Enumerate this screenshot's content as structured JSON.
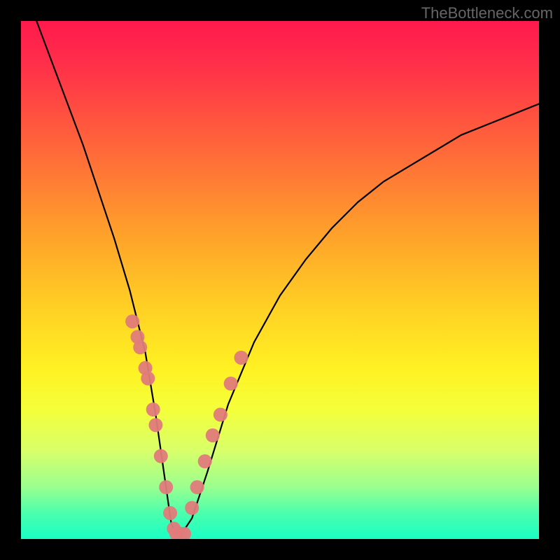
{
  "watermark": "TheBottleneck.com",
  "chart_data": {
    "type": "line",
    "title": "",
    "xlabel": "",
    "ylabel": "",
    "xlim": [
      0,
      100
    ],
    "ylim": [
      0,
      100
    ],
    "series": [
      {
        "name": "bottleneck-curve",
        "type": "line",
        "color": "#000000",
        "x": [
          3,
          6,
          9,
          12,
          15,
          18,
          21,
          24,
          26,
          28,
          29,
          30,
          31,
          33,
          36,
          40,
          45,
          50,
          55,
          60,
          65,
          70,
          75,
          80,
          85,
          90,
          95,
          100
        ],
        "y": [
          100,
          92,
          84,
          76,
          67,
          58,
          48,
          36,
          24,
          10,
          3,
          1,
          1,
          4,
          13,
          26,
          38,
          47,
          54,
          60,
          65,
          69,
          72,
          75,
          78,
          80,
          82,
          84
        ]
      },
      {
        "name": "highlight-dots-left",
        "type": "scatter",
        "color": "#e07b7b",
        "x": [
          21.5,
          22.5,
          23.0,
          24.0,
          24.5,
          25.5,
          26.0,
          27.0,
          28.0,
          28.8,
          29.5
        ],
        "y": [
          42,
          39,
          37,
          33,
          31,
          25,
          22,
          16,
          10,
          5,
          2
        ]
      },
      {
        "name": "highlight-dots-bottom",
        "type": "scatter",
        "color": "#e07b7b",
        "x": [
          30.0,
          30.8,
          31.5
        ],
        "y": [
          1,
          1,
          1
        ]
      },
      {
        "name": "highlight-dots-right",
        "type": "scatter",
        "color": "#e07b7b",
        "x": [
          33.0,
          34.0,
          35.5,
          37.0,
          38.5,
          40.5,
          42.5
        ],
        "y": [
          6,
          10,
          15,
          20,
          24,
          30,
          35
        ]
      }
    ],
    "gradient_background": {
      "top_color": "#ff1a4d",
      "bottom_color": "#1affc5"
    }
  }
}
